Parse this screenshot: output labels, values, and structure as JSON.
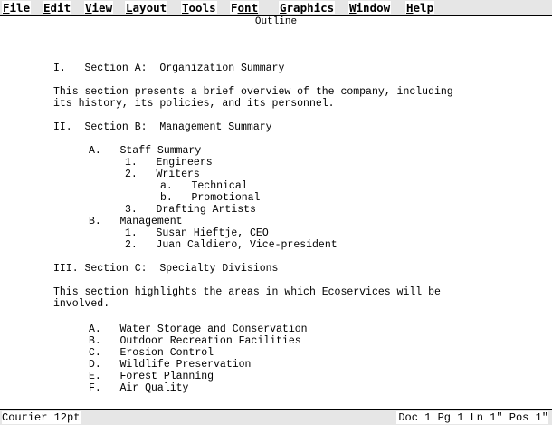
{
  "menu": [
    {
      "accel": "F",
      "rest": "ile"
    },
    {
      "accel": "E",
      "rest": "dit"
    },
    {
      "accel": "V",
      "rest": "iew"
    },
    {
      "accel": "L",
      "rest": "ayout"
    },
    {
      "accel": "T",
      "rest": "ools"
    },
    {
      "accel": "F",
      "rest": "ont",
      "prefix": ""
    },
    {
      "accel": "G",
      "rest": "raphics"
    },
    {
      "accel": "W",
      "rest": "indow"
    },
    {
      "accel": "H",
      "rest": "elp"
    }
  ],
  "document": {
    "title": "Outline",
    "lines": [
      "I.   Section A:  Organization Summary",
      "This section presents a brief overview of the company, including",
      "its history, its policies, and its personnel.",
      "II.  Section B:  Management Summary",
      "A.   Staff Summary",
      "1.   Engineers",
      "2.   Writers",
      "a.   Technical",
      "b.   Promotional",
      "3.   Drafting Artists",
      "B.   Management",
      "1.   Susan Hieftje, CEO",
      "2.   Juan Caldiero, Vice-president",
      "III. Section C:  Specialty Divisions",
      "This section highlights the areas in which Ecoservices will be",
      "involved.",
      "A.   Water Storage and Conservation",
      "B.   Outdoor Recreation Facilities",
      "C.   Erosion Control",
      "D.   Wildlife Preservation",
      "E.   Forest Planning",
      "F.   Air Quality"
    ]
  },
  "status": {
    "font": "Courier 12pt",
    "position": "Doc 1 Pg 1 Ln 1\" Pos 1\""
  }
}
